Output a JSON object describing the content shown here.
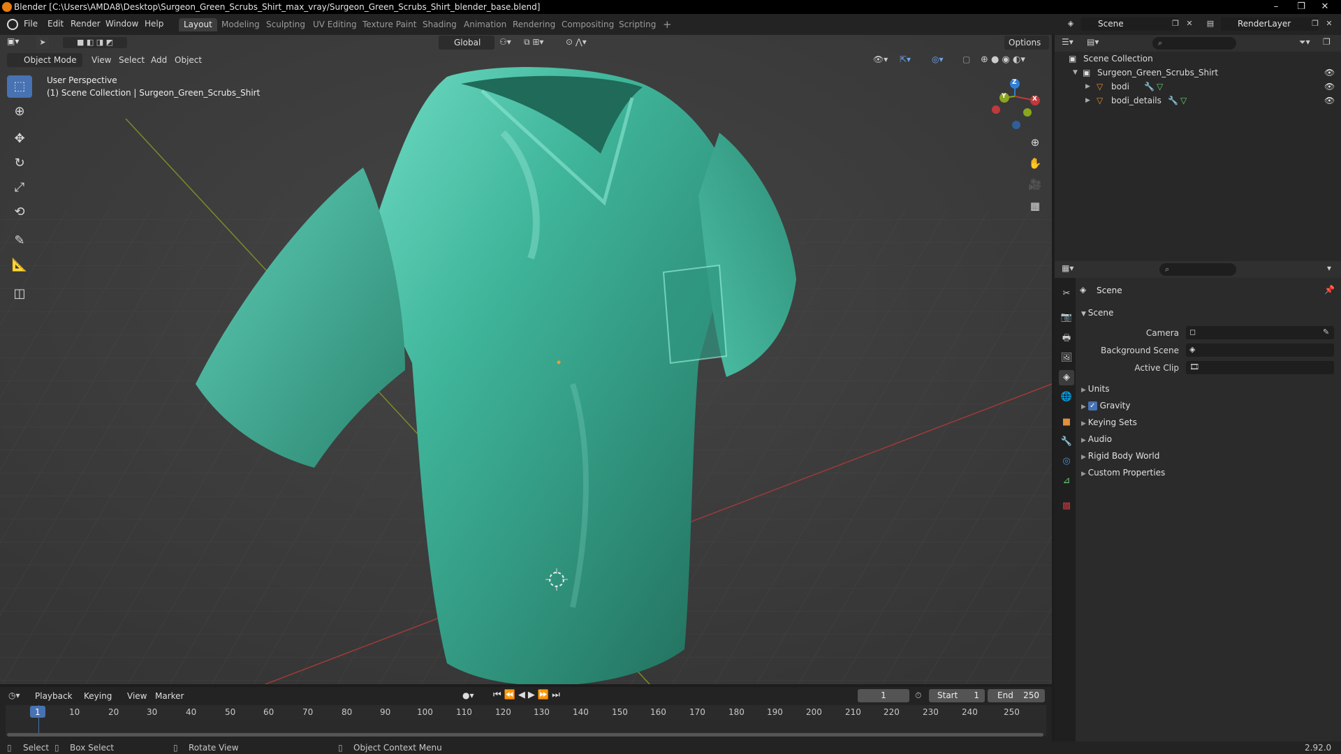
{
  "window": {
    "title": "Blender [C:\\Users\\AMDA8\\Desktop\\Surgeon_Green_Scrubs_Shirt_max_vray/Surgeon_Green_Scrubs_Shirt_blender_base.blend]",
    "minimize": "–",
    "maximize": "❐",
    "close": "✕"
  },
  "menu": {
    "items": [
      "File",
      "Edit",
      "Render",
      "Window",
      "Help"
    ]
  },
  "workspaces": {
    "tabs": [
      "Layout",
      "Modeling",
      "Sculpting",
      "UV Editing",
      "Texture Paint",
      "Shading",
      "Animation",
      "Rendering",
      "Compositing",
      "Scripting"
    ],
    "active": "Layout",
    "add": "+"
  },
  "scene_selector": {
    "value": "Scene"
  },
  "renderlayer_selector": {
    "value": "RenderLayer"
  },
  "viewport": {
    "mode": "Object Mode",
    "menus": [
      "View",
      "Select",
      "Add",
      "Object"
    ],
    "transform_orientation": "Global",
    "options": "Options",
    "perspective_label": "User Perspective",
    "collection_label": "(1) Scene Collection | Surgeon_Green_Scrubs_Shirt",
    "gizmo": {
      "x": "X",
      "y": "Y",
      "z": "Z"
    }
  },
  "outliner": {
    "root": "Scene Collection",
    "collection": "Surgeon_Green_Scrubs_Shirt",
    "objects": [
      "bodi",
      "bodi_details"
    ]
  },
  "properties": {
    "header": "Scene",
    "panel": "Scene",
    "fields": [
      {
        "label": "Camera"
      },
      {
        "label": "Background Scene"
      },
      {
        "label": "Active Clip"
      }
    ],
    "subpanels": [
      "Units",
      "Gravity",
      "Keying Sets",
      "Audio",
      "Rigid Body World",
      "Custom Properties"
    ],
    "gravity_checked": true
  },
  "timeline": {
    "menus": [
      "Playback",
      "Keying",
      "View",
      "Marker"
    ],
    "current_frame": "1",
    "start_label": "Start",
    "start": "1",
    "end_label": "End",
    "end": "250",
    "ticks": [
      "1",
      "10",
      "20",
      "30",
      "40",
      "50",
      "60",
      "70",
      "80",
      "90",
      "100",
      "110",
      "120",
      "130",
      "140",
      "150",
      "160",
      "170",
      "180",
      "190",
      "200",
      "210",
      "220",
      "230",
      "240",
      "250"
    ]
  },
  "statusbar": {
    "select": "Select",
    "box_select": "Box Select",
    "rotate_view": "Rotate View",
    "context_menu": "Object Context Menu",
    "version": "2.92.0"
  },
  "colors": {
    "accent": "#4772b3",
    "shirt": "#3fb59a",
    "x_axis": "#c0393b",
    "y_axis": "#8aa520",
    "z_axis": "#2f7fd6"
  }
}
